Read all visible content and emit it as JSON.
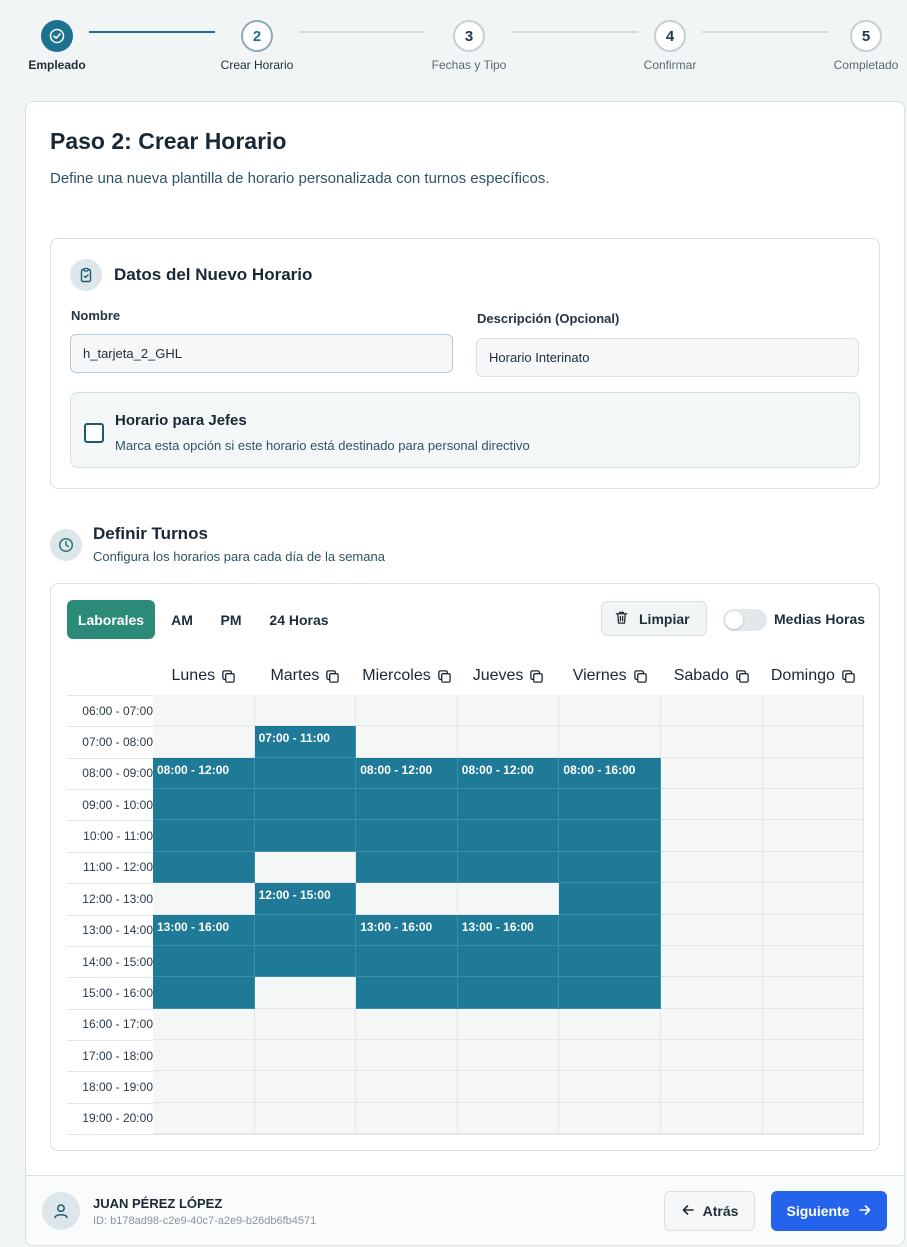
{
  "stepper": {
    "steps": [
      {
        "number": "",
        "label": "Empleado",
        "state": "done"
      },
      {
        "number": "2",
        "label": "Crear Horario",
        "state": "current"
      },
      {
        "number": "3",
        "label": "Fechas y Tipo",
        "state": "pending"
      },
      {
        "number": "4",
        "label": "Confirmar",
        "state": "pending"
      },
      {
        "number": "5",
        "label": "Completado",
        "state": "pending"
      }
    ]
  },
  "header": {
    "title": "Paso 2: Crear Horario",
    "subtitle": "Define una nueva plantilla de horario personalizada con turnos específicos."
  },
  "datos": {
    "title": "Datos del Nuevo Horario",
    "nombre_label": "Nombre",
    "nombre_value": "h_tarjeta_2_GHL",
    "descripcion_label": "Descripción (Opcional)",
    "descripcion_value": "Horario Interinato",
    "jefes_title": "Horario para Jefes",
    "jefes_sub": "Marca esta opción si este horario está destinado para personal directivo",
    "jefes_checked": false
  },
  "turnos": {
    "title": "Definir Turnos",
    "subtitle": "Configura los horarios para cada día de la semana",
    "tabs": [
      "Laborales",
      "AM",
      "PM",
      "24 Horas"
    ],
    "active_tab": "Laborales",
    "clear_label": "Limpiar",
    "half_hours_label": "Medias Horas",
    "half_hours_on": false,
    "days": [
      "Lunes",
      "Martes",
      "Miercoles",
      "Jueves",
      "Viernes",
      "Sabado",
      "Domingo"
    ],
    "time_slots": [
      "06:00 - 07:00",
      "07:00 - 08:00",
      "08:00 - 09:00",
      "09:00 - 10:00",
      "10:00 - 11:00",
      "11:00 - 12:00",
      "12:00 - 13:00",
      "13:00 - 14:00",
      "14:00 - 15:00",
      "15:00 - 16:00",
      "16:00 - 17:00",
      "17:00 - 18:00",
      "18:00 - 19:00",
      "19:00 - 20:00"
    ],
    "shifts": [
      {
        "day": 0,
        "start": 8,
        "end": 12,
        "label": "08:00 - 12:00"
      },
      {
        "day": 0,
        "start": 13,
        "end": 16,
        "label": "13:00 - 16:00"
      },
      {
        "day": 1,
        "start": 7,
        "end": 11,
        "label": "07:00 - 11:00"
      },
      {
        "day": 1,
        "start": 12,
        "end": 15,
        "label": "12:00 - 15:00"
      },
      {
        "day": 2,
        "start": 8,
        "end": 12,
        "label": "08:00 - 12:00"
      },
      {
        "day": 2,
        "start": 13,
        "end": 16,
        "label": "13:00 - 16:00"
      },
      {
        "day": 3,
        "start": 8,
        "end": 12,
        "label": "08:00 - 12:00"
      },
      {
        "day": 3,
        "start": 13,
        "end": 16,
        "label": "13:00 - 16:00"
      },
      {
        "day": 4,
        "start": 8,
        "end": 16,
        "label": "08:00 - 16:00"
      }
    ],
    "first_hour": 6
  },
  "footer": {
    "user_name": "JUAN PÉREZ LÓPEZ",
    "user_id": "ID: b178ad98-c2e9-40c7-a2e9-b26db6fb4571",
    "back_label": "Atrás",
    "next_label": "Siguiente"
  },
  "colors": {
    "accent": "#1e7291",
    "shift": "#1e7a96",
    "tab_active": "#2c8a78",
    "primary_button": "#2463eb"
  }
}
